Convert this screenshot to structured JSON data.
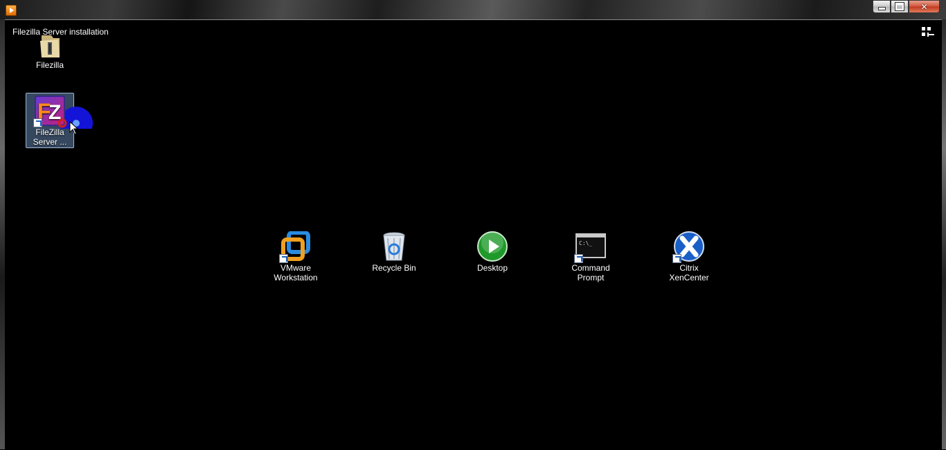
{
  "window": {
    "caption_buttons": {
      "minimize": "minimize",
      "maximize": "maximize",
      "close": "close"
    }
  },
  "vm": {
    "title": "Filezilla Server installation"
  },
  "desktop": {
    "top_icons": [
      {
        "label": "Filezilla",
        "icon": "folder-icon"
      },
      {
        "label": "FileZilla Server ...",
        "icon": "filezilla-server-icon",
        "selected": true
      }
    ],
    "row_icons": [
      {
        "label_line1": "VMware",
        "label_line2": "Workstation",
        "icon": "vmware-icon"
      },
      {
        "label_line1": "Recycle Bin",
        "label_line2": "",
        "icon": "recycle-bin-icon"
      },
      {
        "label_line1": "Desktop",
        "label_line2": "",
        "icon": "play-desktop-icon"
      },
      {
        "label_line1": "Command",
        "label_line2": "Prompt",
        "icon": "command-prompt-icon"
      },
      {
        "label_line1": "Citrix",
        "label_line2": "XenCenter",
        "icon": "citrix-xencenter-icon"
      }
    ]
  },
  "colors": {
    "accent": "#1f5fb8",
    "selection": "#78a0d2",
    "close": "#c13a1f"
  }
}
